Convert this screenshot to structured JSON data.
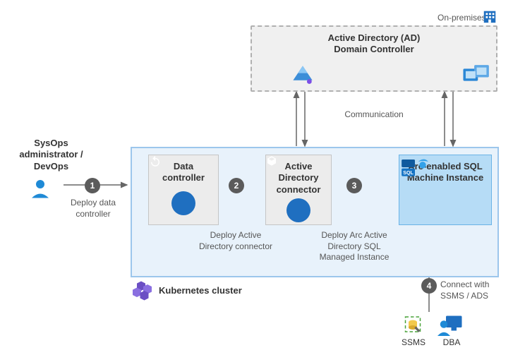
{
  "onprem": {
    "tag": "On-premises",
    "title_line1": "Active Directory (AD)",
    "title_line2": "Domain Controller",
    "comm_label": "Communication"
  },
  "persona": {
    "line1": "SysOps",
    "line2": "administrator /",
    "line3": "DevOps"
  },
  "cluster": {
    "label": "Kubernetes cluster",
    "data_controller": {
      "name": "Data",
      "sub": "controller"
    },
    "ad_connector": {
      "name": "Active",
      "sub1": "Directory",
      "sub2": "connector"
    },
    "arc_sql": {
      "name": "Arc-enabled SQL",
      "sub": "Machine Instance"
    }
  },
  "steps": {
    "s1": {
      "num": "1",
      "label_l1": "Deploy data",
      "label_l2": "controller"
    },
    "s2": {
      "num": "2",
      "label_l1": "Deploy Active",
      "label_l2": "Directory connector"
    },
    "s3": {
      "num": "3",
      "label_l1": "Deploy Arc Active",
      "label_l2": "Directory SQL",
      "label_l3": "Managed Instance"
    },
    "s4": {
      "num": "4",
      "label_l1": "Connect with",
      "label_l2": "SSMS / ADS"
    }
  },
  "clients": {
    "ssms": "SSMS",
    "dba": "DBA"
  },
  "icons": {
    "building": "building-icon",
    "ad_prism": "ad-prism-icon",
    "servers": "servers-icon",
    "user": "user-icon",
    "refresh": "refresh-icon",
    "cube": "cube-icon",
    "sql": "sql-icon",
    "k8s": "kubernetes-icon",
    "ssms": "ssms-icon",
    "dba": "dba-user-icon"
  }
}
